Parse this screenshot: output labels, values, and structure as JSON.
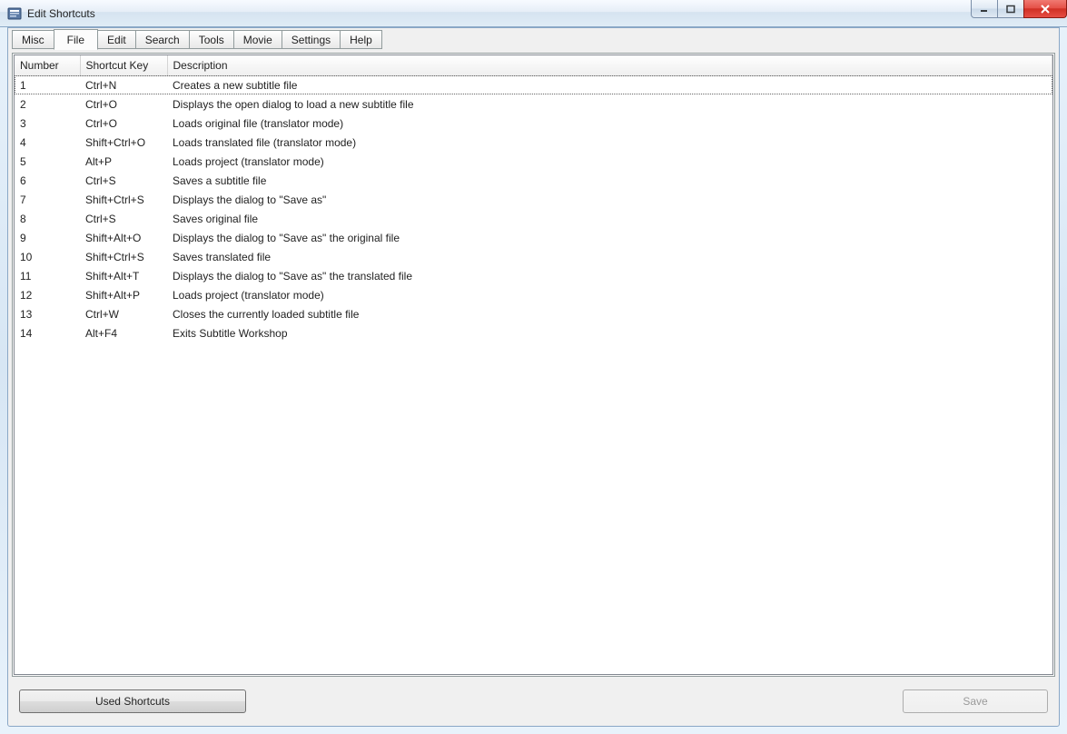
{
  "window": {
    "title": "Edit Shortcuts"
  },
  "tabs": [
    {
      "label": "Misc"
    },
    {
      "label": "File"
    },
    {
      "label": "Edit"
    },
    {
      "label": "Search"
    },
    {
      "label": "Tools"
    },
    {
      "label": "Movie"
    },
    {
      "label": "Settings"
    },
    {
      "label": "Help"
    }
  ],
  "active_tab_index": 1,
  "columns": {
    "number": "Number",
    "shortcut": "Shortcut Key",
    "description": "Description"
  },
  "rows": [
    {
      "number": "1",
      "key": "Ctrl+N",
      "desc": "Creates a new subtitle file"
    },
    {
      "number": "2",
      "key": "Ctrl+O",
      "desc": "Displays the open dialog to load a new subtitle file"
    },
    {
      "number": "3",
      "key": "Ctrl+O",
      "desc": "Loads original file (translator mode)"
    },
    {
      "number": "4",
      "key": "Shift+Ctrl+O",
      "desc": "Loads translated file (translator mode)"
    },
    {
      "number": "5",
      "key": "Alt+P",
      "desc": "Loads project (translator mode)"
    },
    {
      "number": "6",
      "key": "Ctrl+S",
      "desc": "Saves a subtitle file"
    },
    {
      "number": "7",
      "key": "Shift+Ctrl+S",
      "desc": "Displays the dialog to \"Save as\""
    },
    {
      "number": "8",
      "key": "Ctrl+S",
      "desc": "Saves original file"
    },
    {
      "number": "9",
      "key": "Shift+Alt+O",
      "desc": "Displays the dialog to \"Save as\" the original file"
    },
    {
      "number": "10",
      "key": "Shift+Ctrl+S",
      "desc": "Saves translated file"
    },
    {
      "number": "11",
      "key": "Shift+Alt+T",
      "desc": "Displays the dialog to \"Save as\" the translated file"
    },
    {
      "number": "12",
      "key": "Shift+Alt+P",
      "desc": "Loads project (translator mode)"
    },
    {
      "number": "13",
      "key": "Ctrl+W",
      "desc": "Closes the currently loaded subtitle file"
    },
    {
      "number": "14",
      "key": "Alt+F4",
      "desc": "Exits Subtitle Workshop"
    }
  ],
  "buttons": {
    "used_shortcuts": "Used Shortcuts",
    "save": "Save"
  }
}
